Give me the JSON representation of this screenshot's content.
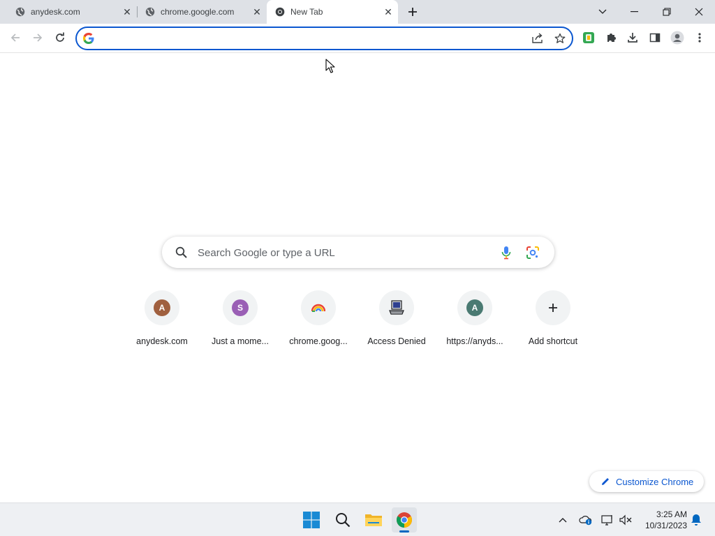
{
  "tabs": [
    {
      "label": "anydesk.com",
      "icon": "globe-icon"
    },
    {
      "label": "chrome.google.com",
      "icon": "globe-icon"
    },
    {
      "label": "New Tab",
      "icon": "chrome-icon"
    }
  ],
  "omnibox": {
    "value": "",
    "placeholder": ""
  },
  "ntp": {
    "search_placeholder": "Search Google or type a URL",
    "shortcuts": [
      {
        "label": "anydesk.com",
        "letter": "A",
        "color": "#a0603f"
      },
      {
        "label": "Just a mome...",
        "letter": "S",
        "color": "#9a5fb5"
      },
      {
        "label": "chrome.goog...",
        "icon": "rainbow-icon"
      },
      {
        "label": "Access Denied",
        "icon": "computer-icon"
      },
      {
        "label": "https://anyds...",
        "letter": "A",
        "color": "#4a7a72"
      },
      {
        "label": "Add shortcut",
        "icon": "plus-icon"
      }
    ],
    "customize_label": "Customize Chrome"
  },
  "taskbar": {
    "time": "3:25 AM",
    "date": "10/31/2023"
  },
  "colors": {
    "accent": "#0b57d0",
    "tabstrip": "#dee1e6"
  }
}
